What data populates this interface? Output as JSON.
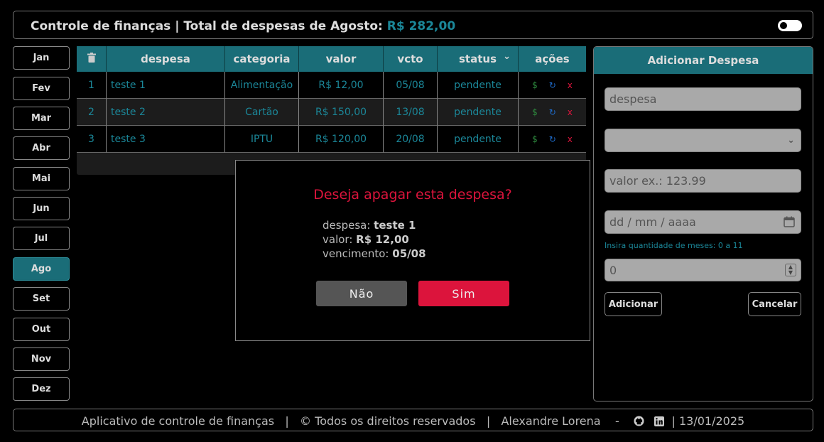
{
  "header": {
    "title": "Controle de finanças | Total de despesas de Agosto:",
    "total": "R$ 282,00"
  },
  "months": [
    "Jan",
    "Fev",
    "Mar",
    "Abr",
    "Mai",
    "Jun",
    "Jul",
    "Ago",
    "Set",
    "Out",
    "Nov",
    "Dez"
  ],
  "active_month": "Ago",
  "table": {
    "headers": {
      "trash": "🗑",
      "despesa": "despesa",
      "categoria": "categoria",
      "valor": "valor",
      "vcto": "vcto",
      "status": "status",
      "status_arrow": "⌄",
      "acoes": "ações"
    },
    "rows": [
      {
        "n": "1",
        "despesa": "teste 1",
        "categoria": "Alimentação",
        "valor": "R$ 12,00",
        "vcto": "05/08",
        "status": "pendente"
      },
      {
        "n": "2",
        "despesa": "teste 2",
        "categoria": "Cartão",
        "valor": "R$ 150,00",
        "vcto": "13/08",
        "status": "pendente"
      },
      {
        "n": "3",
        "despesa": "teste 3",
        "categoria": "IPTU",
        "valor": "R$ 120,00",
        "vcto": "20/08",
        "status": "pendente"
      }
    ],
    "action_icons": {
      "pay": "$",
      "edit": "↻",
      "delete": "x"
    }
  },
  "modal": {
    "question": "Deseja apagar esta despesa?",
    "despesa_label": "despesa:",
    "despesa_value": "teste 1",
    "valor_label": "valor:",
    "valor_value": "R$ 12,00",
    "vencimento_label": "vencimento:",
    "vencimento_value": "05/08",
    "no_label": "Não",
    "yes_label": "Sim"
  },
  "panel": {
    "title": "Adicionar Despesa",
    "despesa_placeholder": "despesa",
    "select_value": "",
    "valor_placeholder": "valor ex.: 123.99",
    "date_placeholder": "dd / mm / aaaa",
    "hint": "Insira quantidade de meses: 0 a 11",
    "meses_value": "0",
    "add_label": "Adicionar",
    "cancel_label": "Cancelar"
  },
  "footer": {
    "app": "Aplicativo de controle de finanças",
    "sep": "|",
    "rights": "© Todos os direitos reservados",
    "author": "Alexandre Lorena",
    "dash": "-",
    "date": "13/01/2025"
  },
  "colors": {
    "accent": "#1a6d78",
    "accent_text": "#1b8799",
    "danger": "#dc143c",
    "pay": "#2e8b3e",
    "edit": "#1f6fd1"
  }
}
